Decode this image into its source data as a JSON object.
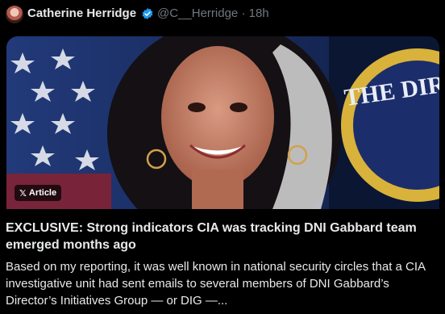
{
  "post": {
    "author_name": "Catherine Herridge",
    "author_handle": "@C__Herridge",
    "separator": "·",
    "time_ago": "18h",
    "verified_icon": "verified-badge-icon",
    "verified_color": "#1d9bf0"
  },
  "card": {
    "badge_label": "Article",
    "badge_icon": "x-logo-icon",
    "seal_text": "THE DIRE",
    "headline": "EXCLUSIVE: Strong indicators CIA was tracking DNI Gabbard team emerged months ago",
    "excerpt": "Based on my reporting, it was well known in national security circles that a CIA investigative unit had sent emails to several members of DNI Gabbard’s Director’s Initiatives Group — or DIG —..."
  },
  "colors": {
    "background": "#000000",
    "text_primary": "#e7e9ea",
    "text_secondary": "#71767b"
  }
}
